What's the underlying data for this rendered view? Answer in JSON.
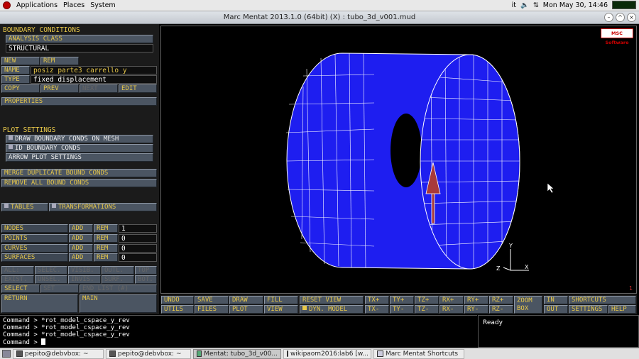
{
  "topbar": {
    "menus": [
      "Applications",
      "Places",
      "System"
    ],
    "locale": "it",
    "clock": "Mon May 30, 14:46"
  },
  "window": {
    "title": "Marc Mentat 2013.1.0 (64bit) (X) : tubo_3d_v001.mud"
  },
  "left": {
    "bc_header": "BOUNDARY CONDITIONS",
    "analysis_class_label": "ANALYSIS CLASS",
    "analysis_class_value": "STRUCTURAL",
    "new": "NEW",
    "rem": "REM",
    "name_label": "NAME",
    "name_value": "posiz_parte3_carrello_y",
    "type_label": "TYPE",
    "type_value": "fixed_displacement",
    "copy": "COPY",
    "prev": "PREV",
    "next": "NEXT",
    "edit": "EDIT",
    "properties": "PROPERTIES",
    "plot_settings": "PLOT SETTINGS",
    "draw_bc": "DRAW BOUNDARY CONDS ON MESH",
    "id_bc": "ID BOUNDARY CONDS",
    "arrow_plot": "ARROW PLOT SETTINGS",
    "merge": "MERGE DUPLICATE BOUND CONDS",
    "remove_all": "REMOVE ALL BOUND CONDS",
    "tables": "TABLES",
    "transformations": "TRANSFORMATIONS",
    "entities": [
      {
        "name": "NODES",
        "add": "ADD",
        "rem": "REM",
        "count": "1"
      },
      {
        "name": "POINTS",
        "add": "ADD",
        "rem": "REM",
        "count": "0"
      },
      {
        "name": "CURVES",
        "add": "ADD",
        "rem": "REM",
        "count": "0"
      },
      {
        "name": "SURFACES",
        "add": "ADD",
        "rem": "REM",
        "count": "0"
      }
    ],
    "sel_row1": [
      "ALL:",
      "SELEC.",
      "VISIB.",
      "OUTL.",
      "TOP"
    ],
    "sel_row2": [
      "EXIST.",
      "UNSEL.",
      "INVIS.",
      "SURF.",
      "BOT."
    ],
    "select": "SELECT",
    "set": "SET",
    "end_list": "END LIST (#)",
    "return": "RETURN",
    "main": "MAIN"
  },
  "viewport": {
    "logo": "MSC Software",
    "axis_y": "Y",
    "axis_x": "X",
    "axis_z": "Z",
    "corner": "1"
  },
  "bottom": {
    "undo": "UNDO",
    "save": "SAVE",
    "draw": "DRAW",
    "fill": "FILL",
    "reset_view": "RESET VIEW",
    "tx_plus": "TX+",
    "ty_plus": "TY+",
    "tz_plus": "TZ+",
    "rx_plus": "RX+",
    "ry_plus": "RY+",
    "rz_plus": "RZ+",
    "zoom_box": "ZOOM BOX",
    "in": "IN",
    "shortcuts": "SHORTCUTS",
    "utils": "UTILS",
    "files": "FILES",
    "plot": "PLOT",
    "view": "VIEW",
    "dyn_model": "DYN. MODEL",
    "tx_minus": "TX-",
    "ty_minus": "TY-",
    "tz_minus": "TZ-",
    "rx_minus": "RX-",
    "ry_minus": "RY-",
    "rz_minus": "RZ-",
    "out": "OUT",
    "settings": "SETTINGS",
    "help": "HELP"
  },
  "command": {
    "lines": [
      "Command > *rot_model_cspace_y_rev",
      "Command > *rot_model_cspace_y_rev",
      "Command > *rot_model_cspace_y_rev"
    ],
    "prompt": "Command >"
  },
  "status": {
    "text": "Ready"
  },
  "taskbar": {
    "items": [
      "pepito@debvbox: ~",
      "pepito@debvbox: ~",
      "Mentat: tubo_3d_v00...",
      "wikipaom2016:lab6 [w...",
      "Marc Mentat Shortcuts"
    ]
  },
  "colors": {
    "mesh": "#1e1ef0",
    "mesh_line": "#ffffff",
    "arrow": "#a83a3a",
    "label": "#e8c84a",
    "panel": "#4b5562"
  }
}
